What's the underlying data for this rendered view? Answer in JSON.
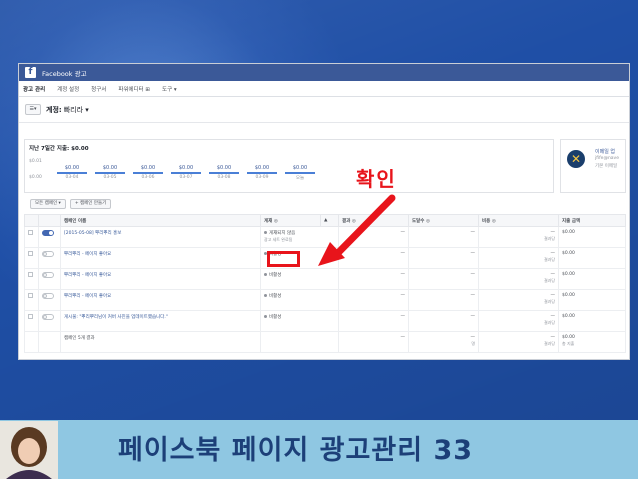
{
  "colors": {
    "background": "#1f4fa6",
    "fb_blue": "#3b5998",
    "highlight_red": "#e8141b",
    "footer_band": "#8fc7e2",
    "footer_text": "#1c3f78"
  },
  "window": {
    "logo_glyph": "f",
    "title": "Facebook 광고"
  },
  "menu": [
    "광고 관리",
    "계정 설정",
    "청구서",
    "파워에디터 ⊞",
    "도구 ▾"
  ],
  "account": {
    "button_icon": "menu-dropdown-icon",
    "button_glyph": "☰▾",
    "label": "계정:",
    "name": "빠리라 ▾"
  },
  "stats": {
    "spend_label": "지난 7일간 지출: $0.00",
    "y_top": "$0.01",
    "y_bottom": "$0.00",
    "days": [
      {
        "value": "$0.00",
        "date": "03-04"
      },
      {
        "value": "$0.00",
        "date": "03-05"
      },
      {
        "value": "$0.00",
        "date": "03-06"
      },
      {
        "value": "$0.00",
        "date": "03-07"
      },
      {
        "value": "$0.00",
        "date": "03-08"
      },
      {
        "value": "$0.00",
        "date": "03-09"
      },
      {
        "value": "$0.00",
        "date": "오늘"
      }
    ]
  },
  "promo": {
    "title": "이메일 업",
    "line1": "jfife@nave",
    "line2": "기본 이메일"
  },
  "toolbar": {
    "filter": "모든 캠페인 ▾",
    "create": "+ 캠페인 만들기"
  },
  "table": {
    "headers": [
      "",
      "",
      "캠페인 이름",
      "게재 ◎",
      "▲",
      "결과 ◎",
      "도달수 ◎",
      "비용 ◎",
      "지출 금액"
    ],
    "rows": [
      {
        "toggle": true,
        "name": "[2015-05-08] 뿌리뿌리 홍보",
        "status": "게재되지 않음",
        "status_sub": "광고 세트 완료됨",
        "result": "—",
        "reach": "—",
        "cost": "—",
        "cost_sub": "결과당",
        "spend": "$0.00"
      },
      {
        "toggle": false,
        "name": "뿌리뿌리 - 페이지 좋아요",
        "status": "비활성",
        "status_sub": "",
        "result": "—",
        "reach": "—",
        "cost": "—",
        "cost_sub": "결과당",
        "spend": "$0.00"
      },
      {
        "toggle": false,
        "name": "뿌리뿌리 - 페이지 좋아요",
        "status": "비활성",
        "status_sub": "",
        "result": "—",
        "reach": "—",
        "cost": "—",
        "cost_sub": "결과당",
        "spend": "$0.00"
      },
      {
        "toggle": false,
        "name": "뿌리뿌리 - 페이지 좋아요",
        "status": "비활성",
        "status_sub": "",
        "result": "—",
        "reach": "—",
        "cost": "—",
        "cost_sub": "결과당",
        "spend": "$0.00"
      },
      {
        "toggle": false,
        "name": "게시물: \"뿌리뿌리님이 커버 사진을 업데이트했습니다.\"",
        "status": "비활성",
        "status_sub": "",
        "result": "—",
        "reach": "—",
        "cost": "—",
        "cost_sub": "결과당",
        "spend": "$0.00"
      }
    ],
    "summary": {
      "name": "캠페인 5개 결과",
      "result": "—",
      "reach": "—",
      "reach_sub": "명",
      "cost": "—",
      "cost_sub": "결과당",
      "spend": "$0.00",
      "spend_sub": "총 지출"
    }
  },
  "annotation": "확인",
  "footer": {
    "title": "페이스북 페이지 광고관리 33"
  }
}
